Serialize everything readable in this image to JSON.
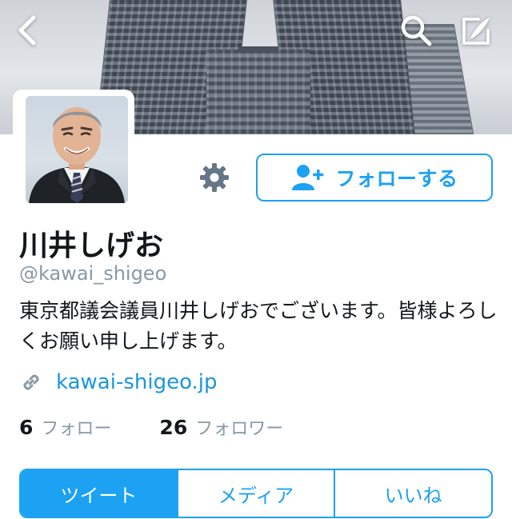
{
  "header": {
    "back_icon": "chevron-left-icon",
    "search_icon": "search-icon",
    "compose_icon": "compose-tweet-icon"
  },
  "profile": {
    "name": "川井しげお",
    "handle": "@kawai_shigeo",
    "bio": "東京都議会議員川井しげおでございます。皆様よろしくお願い申し上げます。",
    "website": "kawai-shigeo.jp",
    "website_icon": "link-icon"
  },
  "actions": {
    "settings_icon": "gear-icon",
    "follow_icon": "add-user-icon",
    "follow_label": "フォローする"
  },
  "stats": {
    "following_count": "6",
    "following_label": "フォロー",
    "followers_count": "26",
    "followers_label": "フォロワー"
  },
  "tabs": [
    {
      "label": "ツイート",
      "active": true
    },
    {
      "label": "メディア",
      "active": false
    },
    {
      "label": "いいね",
      "active": false
    }
  ],
  "colors": {
    "accent": "#1da1f2",
    "link": "#1b95e0",
    "secondary_text": "#8899a6",
    "icon_gray": "#657786"
  }
}
